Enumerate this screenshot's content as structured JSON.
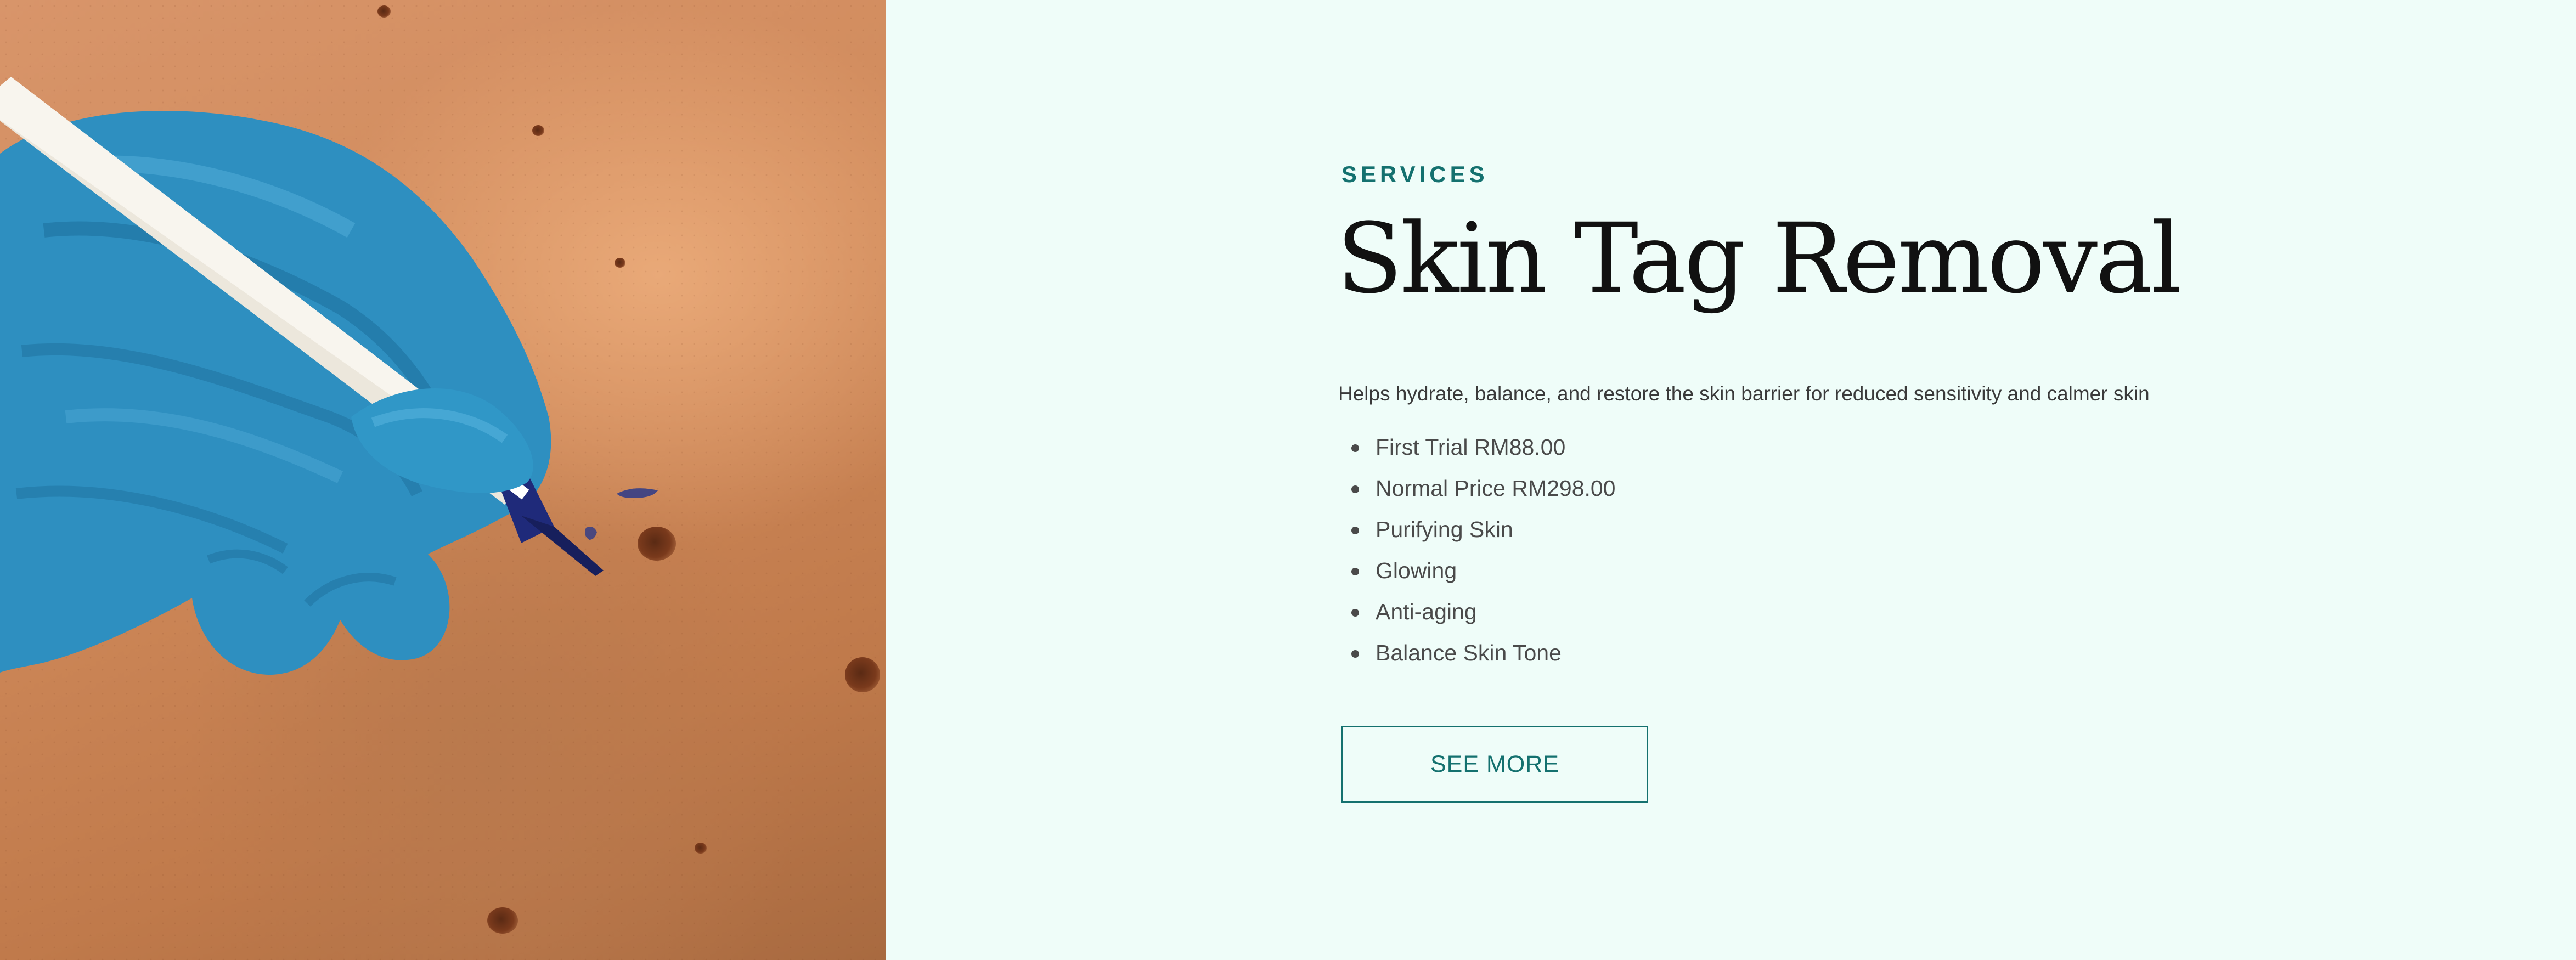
{
  "hero_image": {
    "description_icon": "gloved-hand-marking-skin-image"
  },
  "services": {
    "eyebrow": "SERVICES",
    "title": "Skin Tag Removal",
    "description": "Helps hydrate, balance, and restore the skin barrier for reduced sensitivity and calmer skin",
    "features": [
      "First Trial RM88.00",
      "Normal Price RM298.00",
      "Purifying Skin",
      "Glowing",
      "Anti-aging",
      "Balance Skin Tone"
    ],
    "cta_label": "SEE MORE"
  },
  "colors": {
    "background": "#effdf9",
    "accent": "#14716f",
    "title": "#111111",
    "body_text": "#4a4a4a"
  }
}
